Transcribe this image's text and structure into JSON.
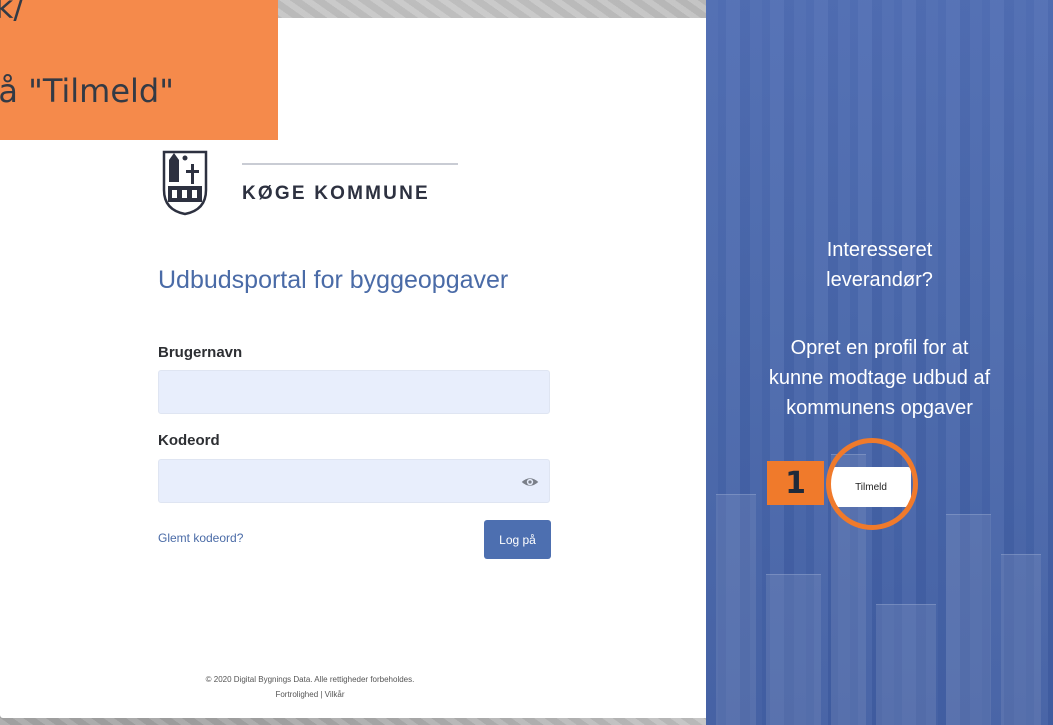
{
  "tutorial": {
    "banner_line1": "ik/",
    "banner_line2": "på \"Tilmeld\"",
    "step_number": "1",
    "accent_color": "#f07a2b"
  },
  "brand": {
    "logo_icon": "koge-crest-icon",
    "name": "KØGE KOMMUNE"
  },
  "login": {
    "portal_title": "Udbudsportal for byggeopgaver",
    "username_label": "Brugernavn",
    "username_value": "",
    "password_label": "Kodeord",
    "password_value": "",
    "show_password_icon": "eye-icon",
    "forgot_link": "Glemt kodeord?",
    "login_button": "Log på"
  },
  "footer": {
    "copyright": "© 2020 Digital Bygnings Data. Alle rettigheder forbeholdes.",
    "links": "Fortrolighed | Vilkår"
  },
  "signup_panel": {
    "heading_line1": "Interesseret",
    "heading_line2": "leverandør?",
    "body_line1": "Opret en profil for at",
    "body_line2": "kunne modtage udbud af",
    "body_line3": "kommunens opgaver",
    "signup_button": "Tilmeld",
    "panel_color": "#4a6cb2"
  }
}
